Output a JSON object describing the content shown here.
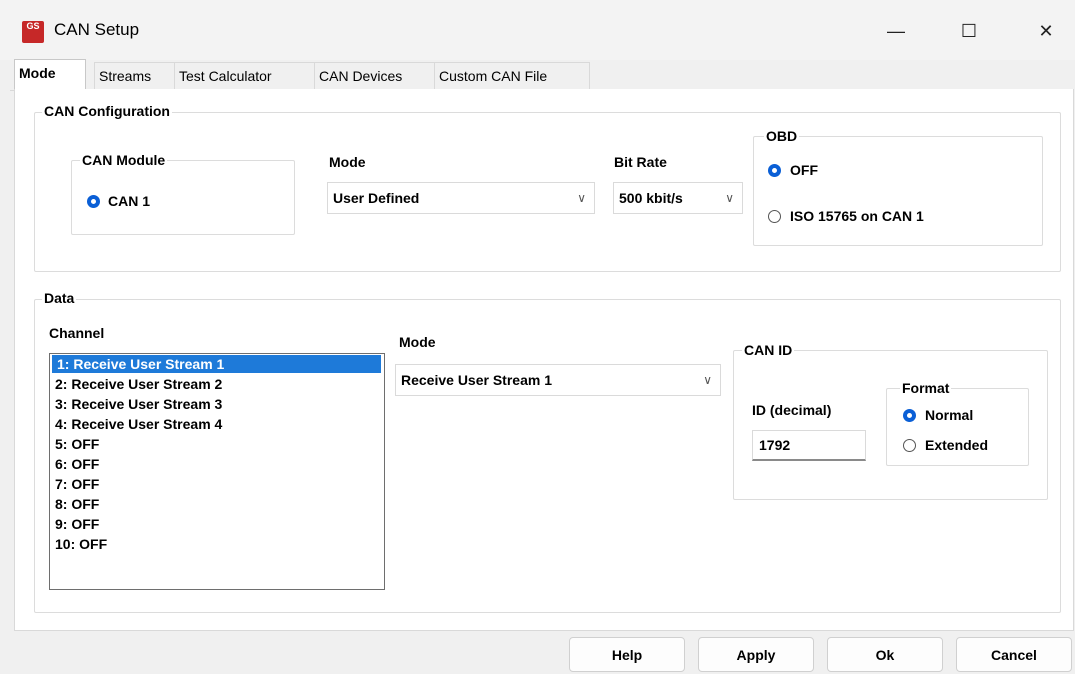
{
  "window": {
    "title": "CAN Setup",
    "app_icon_text": "GS",
    "minimize": "—",
    "maximize": "☐",
    "close": "✕"
  },
  "tabs": [
    "Mode",
    "Streams",
    "Test Calculator",
    "CAN Devices",
    "Custom CAN File"
  ],
  "can_config": {
    "group_label": "CAN Configuration",
    "module": {
      "label": "CAN Module",
      "option": "CAN 1"
    },
    "mode": {
      "label": "Mode",
      "value": "User Defined"
    },
    "bitrate": {
      "label": "Bit Rate",
      "value": "500 kbit/s"
    },
    "obd": {
      "label": "OBD",
      "opt_off": "OFF",
      "opt_iso": "ISO 15765 on CAN 1"
    }
  },
  "data": {
    "group_label": "Data",
    "channel_label": "Channel",
    "channels": [
      "1: Receive User Stream 1",
      "2: Receive User Stream 2",
      "3: Receive User Stream 3",
      "4: Receive User Stream 4",
      "5: OFF",
      "6: OFF",
      "7: OFF",
      "8: OFF",
      "9: OFF",
      "10: OFF"
    ],
    "mode_label": "Mode",
    "mode_value": "Receive User Stream 1",
    "can_id": {
      "group_label": "CAN ID",
      "id_label": "ID (decimal)",
      "id_value": "1792",
      "format_label": "Format",
      "opt_normal": "Normal",
      "opt_extended": "Extended"
    }
  },
  "buttons": {
    "help": "Help",
    "apply": "Apply",
    "ok": "Ok",
    "cancel": "Cancel"
  },
  "colors": {
    "accent": "#0a5fd6",
    "selection": "#1e7ad9",
    "icon": "#c62828"
  }
}
